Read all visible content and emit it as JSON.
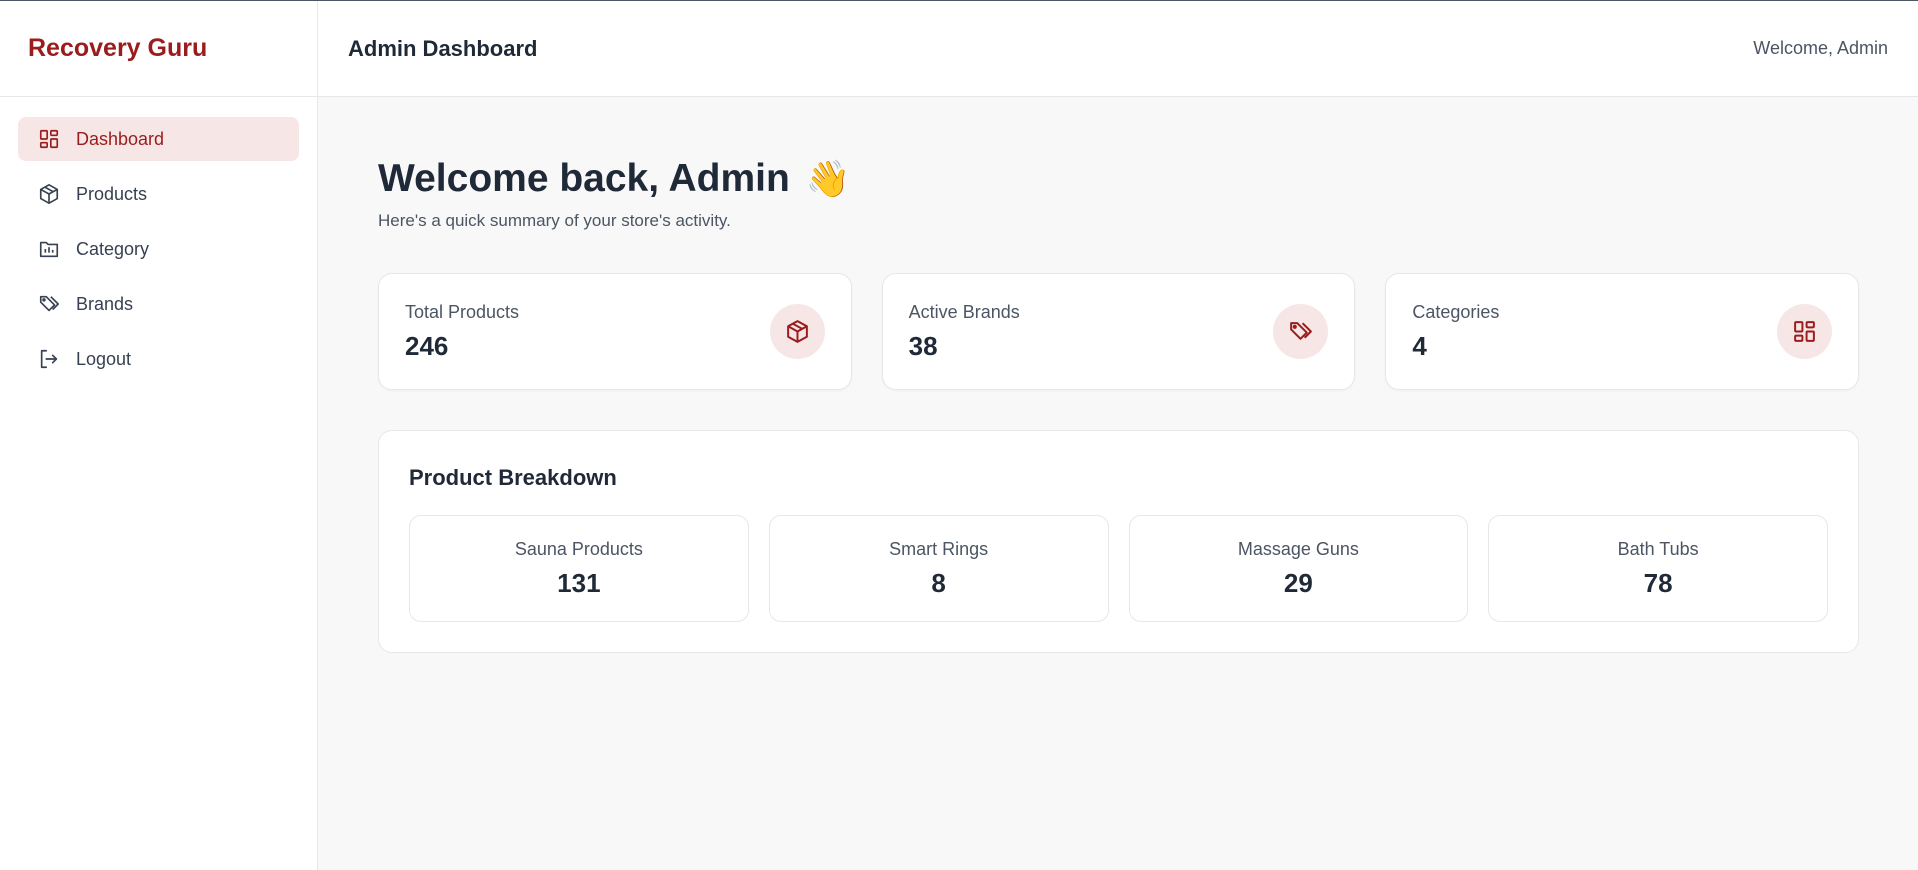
{
  "brand": {
    "name": "Recovery Guru",
    "color": "#9b1c1c"
  },
  "sidebar": {
    "items": [
      {
        "label": "Dashboard",
        "icon": "dashboard-icon",
        "active": true
      },
      {
        "label": "Products",
        "icon": "box-icon",
        "active": false
      },
      {
        "label": "Category",
        "icon": "folder-chart-icon",
        "active": false
      },
      {
        "label": "Brands",
        "icon": "tags-icon",
        "active": false
      },
      {
        "label": "Logout",
        "icon": "logout-icon",
        "active": false
      }
    ]
  },
  "header": {
    "title": "Admin Dashboard",
    "welcome": "Welcome, Admin"
  },
  "main": {
    "title": "Welcome back, Admin",
    "wave_emoji": "👋",
    "subtitle": "Here's a quick summary of your store's activity.",
    "stats": [
      {
        "label": "Total Products",
        "value": "246",
        "icon": "box-icon"
      },
      {
        "label": "Active Brands",
        "value": "38",
        "icon": "tags-icon"
      },
      {
        "label": "Categories",
        "value": "4",
        "icon": "dashboard-icon"
      }
    ],
    "breakdown": {
      "title": "Product Breakdown",
      "items": [
        {
          "label": "Sauna Products",
          "value": "131"
        },
        {
          "label": "Smart Rings",
          "value": "8"
        },
        {
          "label": "Massage Guns",
          "value": "29"
        },
        {
          "label": "Bath Tubs",
          "value": "78"
        }
      ]
    }
  },
  "colors": {
    "accent": "#9b1c1c",
    "accent_bg": "#f7e6e6",
    "page_bg": "#f8f8f8"
  }
}
